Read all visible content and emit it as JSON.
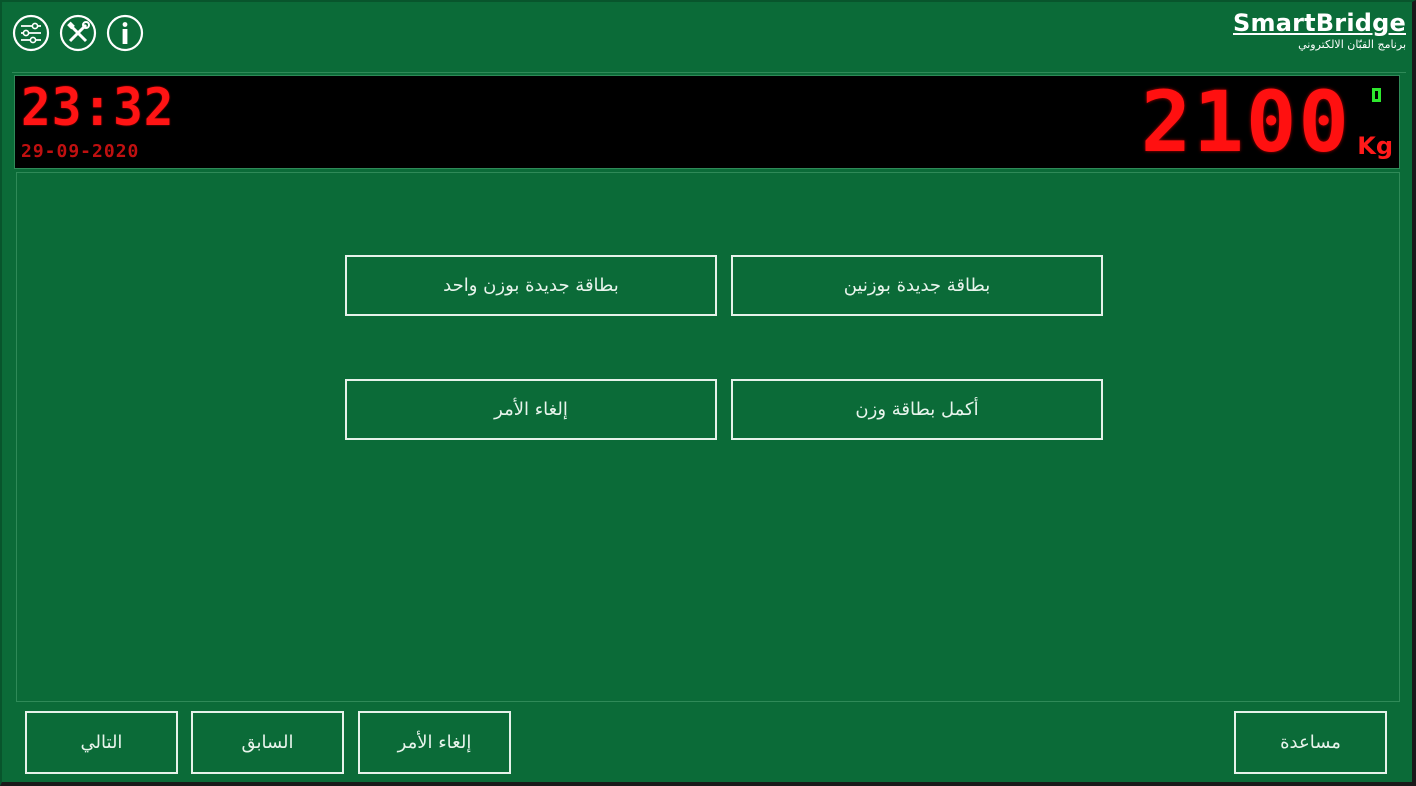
{
  "header": {
    "icons": [
      "settings-sliders-icon",
      "tools-icon",
      "info-icon"
    ],
    "brand_name": "SmartBridge",
    "brand_subtitle": "برنامج القبّان الالكتروني"
  },
  "display": {
    "time": "23:32",
    "date": "29-09-2020",
    "weight": "2100",
    "unit": "Kg",
    "stable_indicator": "[]"
  },
  "menu": {
    "single_weigh_card": "بطاقة جديدة بوزن واحد",
    "two_weigh_card": "بطاقة جديدة بوزنين",
    "cancel": "إلغاء الأمر",
    "complete_card": "أكمل بطاقة وزن"
  },
  "footer": {
    "next": "التالي",
    "previous": "السابق",
    "cancel": "إلغاء الأمر",
    "help": "مساعدة"
  },
  "colors": {
    "background": "#0b6b38",
    "led_red": "#ff1010",
    "indicator_green": "#2ee82e",
    "border": "#e6f2ea"
  }
}
